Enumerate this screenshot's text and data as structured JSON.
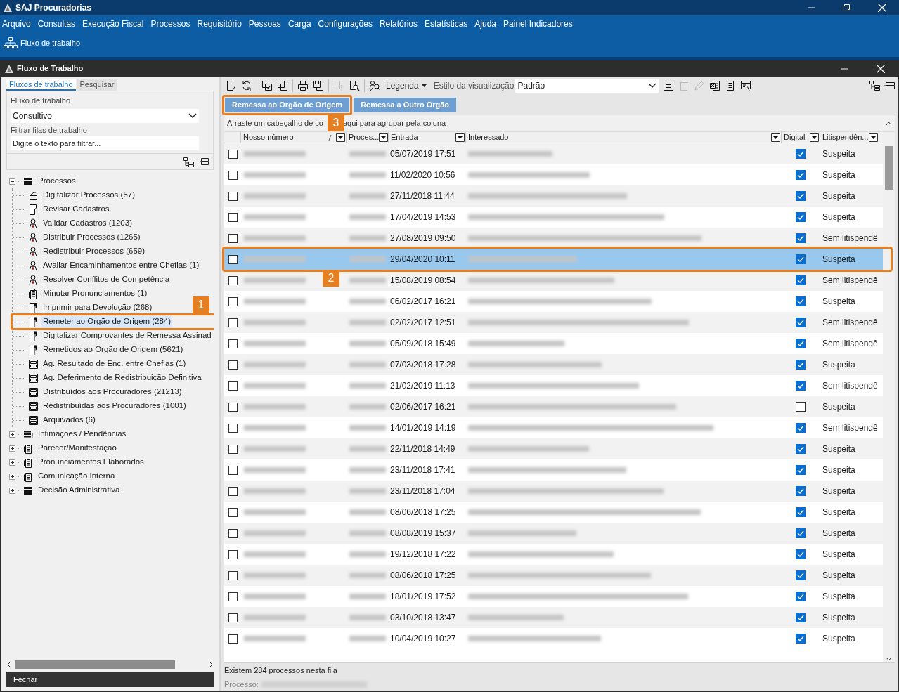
{
  "app_window": {
    "title": "SAJ Procuradorias"
  },
  "menu": [
    "Arquivo",
    "Consultas",
    "Execução Fiscal",
    "Processos",
    "Requisitório",
    "Pessoas",
    "Carga",
    "Configurações",
    "Relatórios",
    "Estatísticas",
    "Ajuda",
    "Painel Indicadores"
  ],
  "ribbon": {
    "button": "Fluxo de trabalho"
  },
  "child_window": {
    "title": "Fluxo de Trabalho"
  },
  "left_tabs": [
    {
      "label": "Fluxos de trabalho",
      "selected": true
    },
    {
      "label": "Pesquisar",
      "selected": false
    }
  ],
  "workflow_field": {
    "label": "Fluxo de trabalho",
    "value": "Consultivo"
  },
  "filter_field": {
    "label": "Filtrar filas de trabalho",
    "placeholder": "Digite o texto para filtrar..."
  },
  "tree": [
    {
      "label": "Processos",
      "kind": "list",
      "expanded": true,
      "children": [
        {
          "label": "Digitalizar Processos (57)",
          "kind": "scanner",
          "selected": false
        },
        {
          "label": "Revisar Cadastros",
          "kind": "document",
          "selected": false
        },
        {
          "label": "Validar Cadastros (1203)",
          "kind": "person",
          "selected": false
        },
        {
          "label": "Distribuir Processos (1265)",
          "kind": "person",
          "selected": false
        },
        {
          "label": "Redistribuir Processos (659)",
          "kind": "person",
          "selected": false
        },
        {
          "label": "Avaliar Encaminhamentos entre Chefias (1)",
          "kind": "person",
          "selected": false
        },
        {
          "label": "Resolver Conflitos de Competência",
          "kind": "person",
          "selected": false
        },
        {
          "label": "Minutar Pronunciamentos (1)",
          "kind": "clipboard",
          "selected": false
        },
        {
          "label": "Imprimir para Devolução (268)",
          "kind": "flag",
          "selected": false
        },
        {
          "label": "Remeter ao Orgão de Origem (284)",
          "kind": "flag",
          "selected": true,
          "callout": "1"
        },
        {
          "label": "Digitalizar Comprovantes de Remessa Assinad",
          "kind": "flag",
          "selected": false
        },
        {
          "label": "Remetidos ao Orgão de Origem (5621)",
          "kind": "flag",
          "selected": false
        },
        {
          "label": "Ag. Resultado de Enc. entre Chefias (1)",
          "kind": "drawer",
          "selected": false
        },
        {
          "label": "Ag. Deferimento de Redistribuição Definitiva",
          "kind": "drawer",
          "selected": false
        },
        {
          "label": "Distribuídos aos Procuradores (21213)",
          "kind": "drawer",
          "selected": false
        },
        {
          "label": "Redistribuídas aos Procuradores (1001)",
          "kind": "drawer",
          "selected": false
        },
        {
          "label": "Arquivados (6)",
          "kind": "drawer",
          "selected": false
        }
      ]
    },
    {
      "label": "Intimações / Pendências",
      "kind": "alertlist",
      "expanded": false
    },
    {
      "label": "Parecer/Manifestação",
      "kind": "clipboard",
      "expanded": false
    },
    {
      "label": "Pronunciamentos Elaborados",
      "kind": "clipboard",
      "expanded": false
    },
    {
      "label": "Comunicação Interna",
      "kind": "clipboard",
      "expanded": false
    },
    {
      "label": "Decisão Administrativa",
      "kind": "list",
      "expanded": false
    }
  ],
  "close_button": "Fechar",
  "toolbar": {
    "legend": "Legenda",
    "style_label": "Estilo da visualização",
    "style_value": "Padrão"
  },
  "action_buttons": [
    {
      "label": "Remessa ao Orgão de Origem",
      "callout": "3"
    },
    {
      "label": "Remessa a Outro Orgão"
    }
  ],
  "group_hint": [
    "Arraste um cabeçalho de co",
    "aqui para agrupar pela coluna"
  ],
  "table": {
    "columns": [
      "Nosso número",
      "Proces...",
      "Entrada",
      "Interessado",
      "Digital",
      "Litispendên..."
    ],
    "rows": [
      {
        "checked": false,
        "entrada": "05/07/2019 17:51",
        "digital": true,
        "litispendencia": "Suspeita",
        "selected": false
      },
      {
        "checked": false,
        "entrada": "11/02/2020 10:56",
        "digital": true,
        "litispendencia": "Suspeita",
        "selected": false
      },
      {
        "checked": false,
        "entrada": "27/11/2018 11:44",
        "digital": true,
        "litispendencia": "Suspeita",
        "selected": false
      },
      {
        "checked": false,
        "entrada": "17/04/2019 14:53",
        "digital": true,
        "litispendencia": "Suspeita",
        "selected": false
      },
      {
        "checked": false,
        "entrada": "27/08/2019 09:50",
        "digital": true,
        "litispendencia": "Sem litispendê",
        "selected": false
      },
      {
        "checked": false,
        "entrada": "29/04/2020 10:11",
        "digital": true,
        "litispendencia": "Suspeita",
        "selected": true,
        "callout": "2"
      },
      {
        "checked": false,
        "entrada": "15/08/2019 08:54",
        "digital": true,
        "litispendencia": "Sem litispendê",
        "selected": false
      },
      {
        "checked": false,
        "entrada": "06/02/2017 16:21",
        "digital": true,
        "litispendencia": "Suspeita",
        "selected": false
      },
      {
        "checked": false,
        "entrada": "02/02/2017 12:51",
        "digital": true,
        "litispendencia": "Sem litispendê",
        "selected": false
      },
      {
        "checked": false,
        "entrada": "05/09/2018 15:49",
        "digital": true,
        "litispendencia": "Sem litispendê",
        "selected": false
      },
      {
        "checked": false,
        "entrada": "07/03/2018 17:28",
        "digital": true,
        "litispendencia": "Suspeita",
        "selected": false
      },
      {
        "checked": false,
        "entrada": "21/02/2019 11:13",
        "digital": true,
        "litispendencia": "Sem litispendê",
        "selected": false
      },
      {
        "checked": false,
        "entrada": "02/06/2017 16:21",
        "digital": false,
        "litispendencia": "Suspeita",
        "selected": false
      },
      {
        "checked": false,
        "entrada": "14/01/2019 14:19",
        "digital": true,
        "litispendencia": "Sem litispendê",
        "selected": false
      },
      {
        "checked": false,
        "entrada": "22/11/2018 14:49",
        "digital": true,
        "litispendencia": "Suspeita",
        "selected": false
      },
      {
        "checked": false,
        "entrada": "23/11/2018 17:41",
        "digital": true,
        "litispendencia": "Suspeita",
        "selected": false
      },
      {
        "checked": false,
        "entrada": "23/11/2018 17:04",
        "digital": true,
        "litispendencia": "Suspeita",
        "selected": false
      },
      {
        "checked": false,
        "entrada": "08/06/2018 17:25",
        "digital": true,
        "litispendencia": "Suspeita",
        "selected": false
      },
      {
        "checked": false,
        "entrada": "08/08/2019 15:37",
        "digital": true,
        "litispendencia": "Suspeita",
        "selected": false
      },
      {
        "checked": false,
        "entrada": "19/12/2018 17:22",
        "digital": true,
        "litispendencia": "Suspeita",
        "selected": false
      },
      {
        "checked": false,
        "entrada": "08/06/2018 17:25",
        "digital": true,
        "litispendencia": "Suspeita",
        "selected": false
      },
      {
        "checked": false,
        "entrada": "18/01/2019 17:52",
        "digital": true,
        "litispendencia": "Suspeita",
        "selected": false
      },
      {
        "checked": false,
        "entrada": "03/10/2018 13:47",
        "digital": true,
        "litispendencia": "Suspeita",
        "selected": false
      },
      {
        "checked": false,
        "entrada": "10/04/2019 10:27",
        "digital": true,
        "litispendencia": "Suspeita",
        "selected": false
      }
    ]
  },
  "status": {
    "count_text": "Existem 284 processos nesta fila",
    "process_label": "Processo:"
  }
}
